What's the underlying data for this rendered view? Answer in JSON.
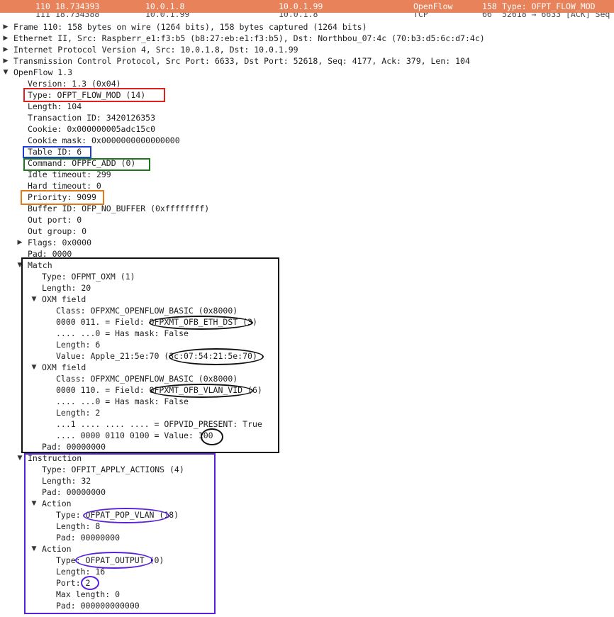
{
  "packet_list": {
    "selected_row": {
      "no": "110",
      "time": "18.734393",
      "source": "10.0.1.8",
      "destination": "10.0.1.99",
      "protocol": "OpenFlow",
      "length": "158",
      "info": "Type: OFPT_FLOW_MOD"
    },
    "next_row": {
      "no": "111",
      "time": "18.734388",
      "source": "10.0.1.99",
      "destination": "10.0.1.8",
      "protocol": "TCP",
      "length": "66",
      "info": "52618 → 6633 [ACK] Seq"
    }
  },
  "details": {
    "frame": "Frame 110: 158 bytes on wire (1264 bits), 158 bytes captured (1264 bits)",
    "ethernet": "Ethernet II, Src: Raspberr_e1:f3:b5 (b8:27:eb:e1:f3:b5), Dst: Northbou_07:4c (70:b3:d5:6c:d7:4c)",
    "ip": "Internet Protocol Version 4, Src: 10.0.1.8, Dst: 10.0.1.99",
    "tcp": "Transmission Control Protocol, Src Port: 6633, Dst Port: 52618, Seq: 4177, Ack: 379, Len: 104",
    "openflow": "OpenFlow 1.3",
    "version": "Version: 1.3 (0x04)",
    "type": "Type: OFPT_FLOW_MOD (14)",
    "length": "Length: 104",
    "transaction_id": "Transaction ID: 3420126353",
    "cookie": "Cookie: 0x000000005adc15c0",
    "cookie_mask": "Cookie mask: 0x0000000000000000",
    "table_id": "Table ID: 6",
    "command": "Command: OFPFC_ADD (0)",
    "idle_timeout": "Idle timeout: 299",
    "hard_timeout": "Hard timeout: 0",
    "priority": "Priority: 9099",
    "buffer_id": "Buffer ID: OFP_NO_BUFFER (0xffffffff)",
    "out_port": "Out port: 0",
    "out_group": "Out group: 0",
    "flags": "Flags: 0x0000",
    "pad": "Pad: 0000",
    "match": {
      "title": "Match",
      "type": "Type: OFPMT_OXM (1)",
      "length": "Length: 20",
      "oxm1": {
        "title": "OXM field",
        "class": "Class: OFPXMC_OPENFLOW_BASIC (0x8000)",
        "field": "0000 011. = Field: OFPXMT_OFB_ETH_DST (3)",
        "has_mask": ".... ...0 = Has mask: False",
        "length": "Length: 6",
        "value": "Value: Apple_21:5e:70 (3c:07:54:21:5e:70)"
      },
      "oxm2": {
        "title": "OXM field",
        "class": "Class: OFPXMC_OPENFLOW_BASIC (0x8000)",
        "field": "0000 110. = Field: OFPXMT_OFB_VLAN_VID (6)",
        "has_mask": ".... ...0 = Has mask: False",
        "length": "Length: 2",
        "vid_present": "...1 .... .... .... = OFPVID_PRESENT: True",
        "value": ".... 0000 0110 0100 = Value: 100"
      },
      "pad": "Pad: 00000000"
    },
    "instruction": {
      "title": "Instruction",
      "type": "Type: OFPIT_APPLY_ACTIONS (4)",
      "length": "Length: 32",
      "pad": "Pad: 00000000",
      "action1": {
        "title": "Action",
        "type": "Type: OFPAT_POP_VLAN (18)",
        "length": "Length: 8",
        "pad": "Pad: 00000000"
      },
      "action2": {
        "title": "Action",
        "type": "Type: OFPAT_OUTPUT (0)",
        "length": "Length: 16",
        "port": "Port: 2",
        "max_length": "Max length: 0",
        "pad": "Pad: 000000000000"
      }
    }
  },
  "icons": {
    "collapsed": "▶",
    "expanded": "▼"
  },
  "colors": {
    "selected_row_bg": "#e8825a",
    "red": "#e0201c",
    "blue": "#1b3fd6",
    "green": "#1a7a1a",
    "orange": "#e07a1a",
    "black": "#111111",
    "purple": "#5a22d8"
  }
}
